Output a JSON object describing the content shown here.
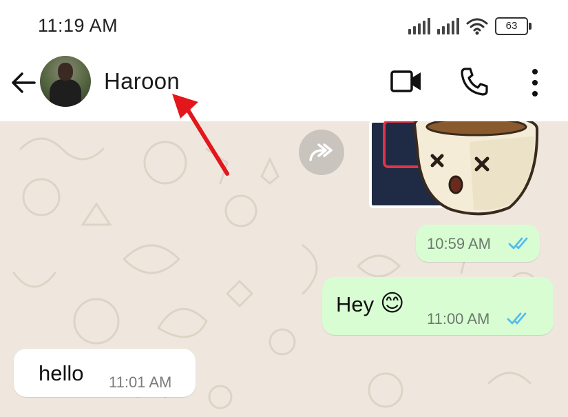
{
  "status_bar": {
    "time": "11:19 AM",
    "battery": "63"
  },
  "header": {
    "contact_name": "Haroon"
  },
  "messages": [
    {
      "direction": "out",
      "type": "sticker",
      "time": "10:59 AM",
      "status": "read"
    },
    {
      "direction": "out",
      "type": "text",
      "text": "Hey",
      "emoji": "😊",
      "time": "11:00 AM",
      "status": "read"
    },
    {
      "direction": "in",
      "type": "text",
      "text": "hello",
      "time": "11:01 AM"
    }
  ],
  "colors": {
    "outgoing_bubble": "#d9fdd3",
    "incoming_bubble": "#ffffff",
    "chat_background": "#efe7dd",
    "read_ticks": "#53bdeb",
    "annotation_arrow": "#e3171b"
  }
}
